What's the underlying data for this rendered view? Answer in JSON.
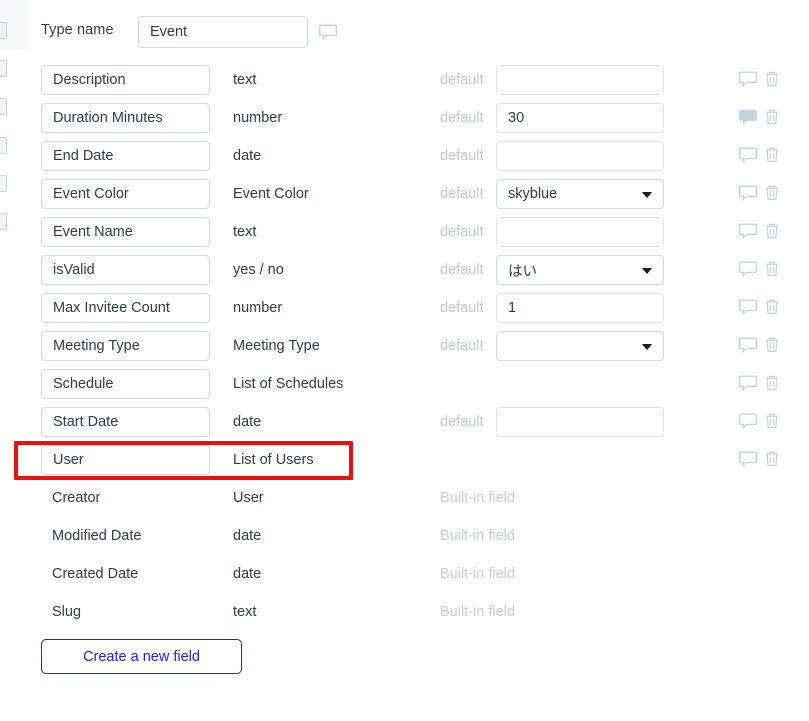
{
  "header": {
    "type_name_label": "Type name",
    "type_name_value": "Event",
    "comment_icon": "speech-bubble-icon"
  },
  "labels": {
    "default": "default",
    "builtin": "Built-in field"
  },
  "fields": [
    {
      "name": "Description",
      "type": "text",
      "editable_name": true,
      "has_default": true,
      "default_kind": "text",
      "default_value": "",
      "comment_state": "empty",
      "has_actions": true
    },
    {
      "name": "Duration Minutes",
      "type": "number",
      "editable_name": true,
      "has_default": true,
      "default_kind": "text",
      "default_value": "30",
      "comment_state": "filled",
      "has_actions": true
    },
    {
      "name": "End Date",
      "type": "date",
      "editable_name": true,
      "has_default": true,
      "default_kind": "text",
      "default_value": "",
      "comment_state": "empty",
      "has_actions": true
    },
    {
      "name": "Event Color",
      "type": "Event Color",
      "editable_name": true,
      "has_default": true,
      "default_kind": "select",
      "default_value": "skyblue",
      "comment_state": "empty",
      "has_actions": true
    },
    {
      "name": "Event Name",
      "type": "text",
      "editable_name": true,
      "has_default": true,
      "default_kind": "text",
      "default_value": "",
      "comment_state": "empty",
      "has_actions": true
    },
    {
      "name": "isValid",
      "type": "yes / no",
      "editable_name": true,
      "has_default": true,
      "default_kind": "select",
      "default_value": "はい",
      "comment_state": "empty",
      "has_actions": true
    },
    {
      "name": "Max Invitee Count",
      "type": "number",
      "editable_name": true,
      "has_default": true,
      "default_kind": "text",
      "default_value": "1",
      "comment_state": "empty",
      "has_actions": true
    },
    {
      "name": "Meeting Type",
      "type": "Meeting Type",
      "editable_name": true,
      "has_default": true,
      "default_kind": "select",
      "default_value": "",
      "comment_state": "empty",
      "has_actions": true
    },
    {
      "name": "Schedule",
      "type": "List of Schedules",
      "editable_name": true,
      "has_default": false,
      "default_kind": "none",
      "default_value": "",
      "comment_state": "empty",
      "has_actions": true
    },
    {
      "name": "Start Date",
      "type": "date",
      "editable_name": true,
      "has_default": true,
      "default_kind": "text",
      "default_value": "",
      "comment_state": "empty",
      "has_actions": true
    },
    {
      "name": "User",
      "type": "List of Users",
      "editable_name": true,
      "has_default": false,
      "default_kind": "none",
      "default_value": "",
      "comment_state": "empty",
      "has_actions": true,
      "highlighted": true
    },
    {
      "name": "Creator",
      "type": "User",
      "editable_name": false,
      "has_default": false,
      "default_kind": "none",
      "default_value": "",
      "comment_state": "none",
      "has_actions": false,
      "builtin": true
    },
    {
      "name": "Modified Date",
      "type": "date",
      "editable_name": false,
      "has_default": false,
      "default_kind": "none",
      "default_value": "",
      "comment_state": "none",
      "has_actions": false,
      "builtin": true
    },
    {
      "name": "Created Date",
      "type": "date",
      "editable_name": false,
      "has_default": false,
      "default_kind": "none",
      "default_value": "",
      "comment_state": "none",
      "has_actions": false,
      "builtin": true
    },
    {
      "name": "Slug",
      "type": "text",
      "editable_name": false,
      "has_default": false,
      "default_kind": "none",
      "default_value": "",
      "comment_state": "none",
      "has_actions": false,
      "builtin": true
    }
  ],
  "drag_handle_count": 6,
  "create_button": {
    "label": "Create a new field"
  },
  "colors": {
    "highlight": "#e8110f",
    "button_blue": "#2323d8",
    "text": "#2c3e50",
    "muted": "#c5cacf",
    "icon": "#c3d2de"
  }
}
